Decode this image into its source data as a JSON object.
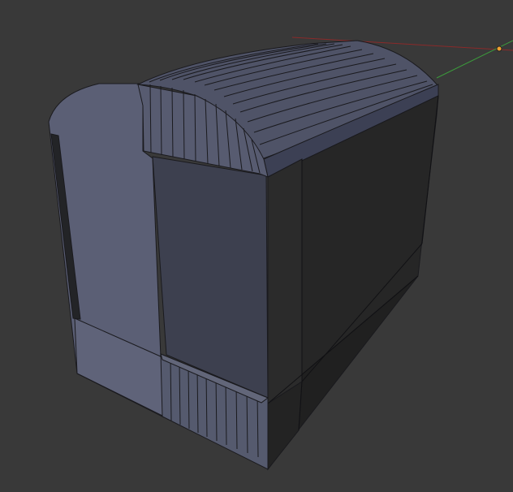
{
  "viewport": {
    "background": "#393939",
    "mode": "edit"
  },
  "axes": {
    "x_axis_color": "#8a2a2a",
    "y_axis_color": "#3c9a3c",
    "origin_color": "#f0a030"
  },
  "mesh": {
    "name": "rounded-box",
    "edge_color": "#1a1a1e",
    "face_colors": {
      "left": "#5a5e74",
      "left_recess": "#50546a",
      "top": "#4e5266",
      "top_rim": "#3e4256",
      "front_upper": "#262626",
      "front_lower": "#1f1f1f",
      "front_column": "#2c2c2c",
      "inner_panel": "#3c3f4e",
      "slot": "#222428"
    }
  }
}
